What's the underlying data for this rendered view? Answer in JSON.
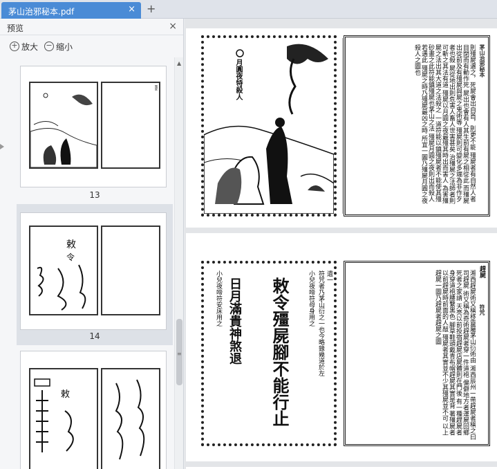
{
  "tabs": [
    {
      "title": "茅山治邪秘本.pdf",
      "close": "×",
      "active": true
    }
  ],
  "tab_add": "+",
  "sidebar": {
    "title": "预览",
    "close": "×",
    "zoom_in": "放大",
    "zoom_out": "缩小",
    "thumbnails": [
      {
        "label": "13",
        "selected": false
      },
      {
        "label": "14",
        "selected": true
      },
      {
        "label": "",
        "selected": false
      }
    ]
  },
  "page_13": {
    "caption": "月圓夜特殺人",
    "header": "茅山治邪秘本",
    "section": "殭屍",
    "text": [
      "則殭屍遇之，死屍會出自首，則更不能",
      "殭屍者有自然人者目閉而有動作死",
      "屍出也會有人其生前有屍之相從此",
      "而殭屍出從前及有殭屍與屍之鬼術等",
      "殭屍則可變化多端為非作歹者也殺",
      "屍從地出則危害人畜人世害甚矣",
      "治殭屍之法師者則可斬之其法有道",
      "殭屍以月圓之夜最殭其時出而害人",
      "為害殭屍之法出其大道之法殺之",
      "一道符能以鎮殭屍者不能使其殭",
      "砂畫之此符能鎮殭屍也茅山之法",
      "殭屍月圓之夜則出而殺人若遇此",
      "殭屍之時乃殭屍最凶之時",
      "所宜一圖乃殭屍月圓之夜殺人之圖也"
    ]
  },
  "page_14": {
    "header_right": "趕屍",
    "section": "符咒",
    "left_title": "小兒夜啼符安床用之",
    "left_text": [
      "小兒夜啼符母身用之",
      "符咒者乃茅山衍之一也今略錄幾道於左",
      "遺一"
    ],
    "talisman_big": "敕令殭屍腳不能行止",
    "talisman_small": "日月滿貴神煞退",
    "text": [
      "湘西趕屍術又稱移靈屬茅山衍術由",
      "湘西辰州一帶趕屍者稱之曰司趕屍",
      "術又稱為奇術趕屍者穿一件道袍",
      "偏僻地方者運屍回鄉死者之家請",
      "天亮以前投宿趕屍店屍體則在門後",
      "有一種趕屍者身穿道袍腰繫黑色",
      "腳草鞋頭戴青布帽趕屍其實是背",
      "著殭屍者以前趕屍時前面的人敲",
      "殭屍者其實並不少其殭屍並不可",
      "以上趕屍一圖乃趕屍者趕屍之圖"
    ]
  }
}
